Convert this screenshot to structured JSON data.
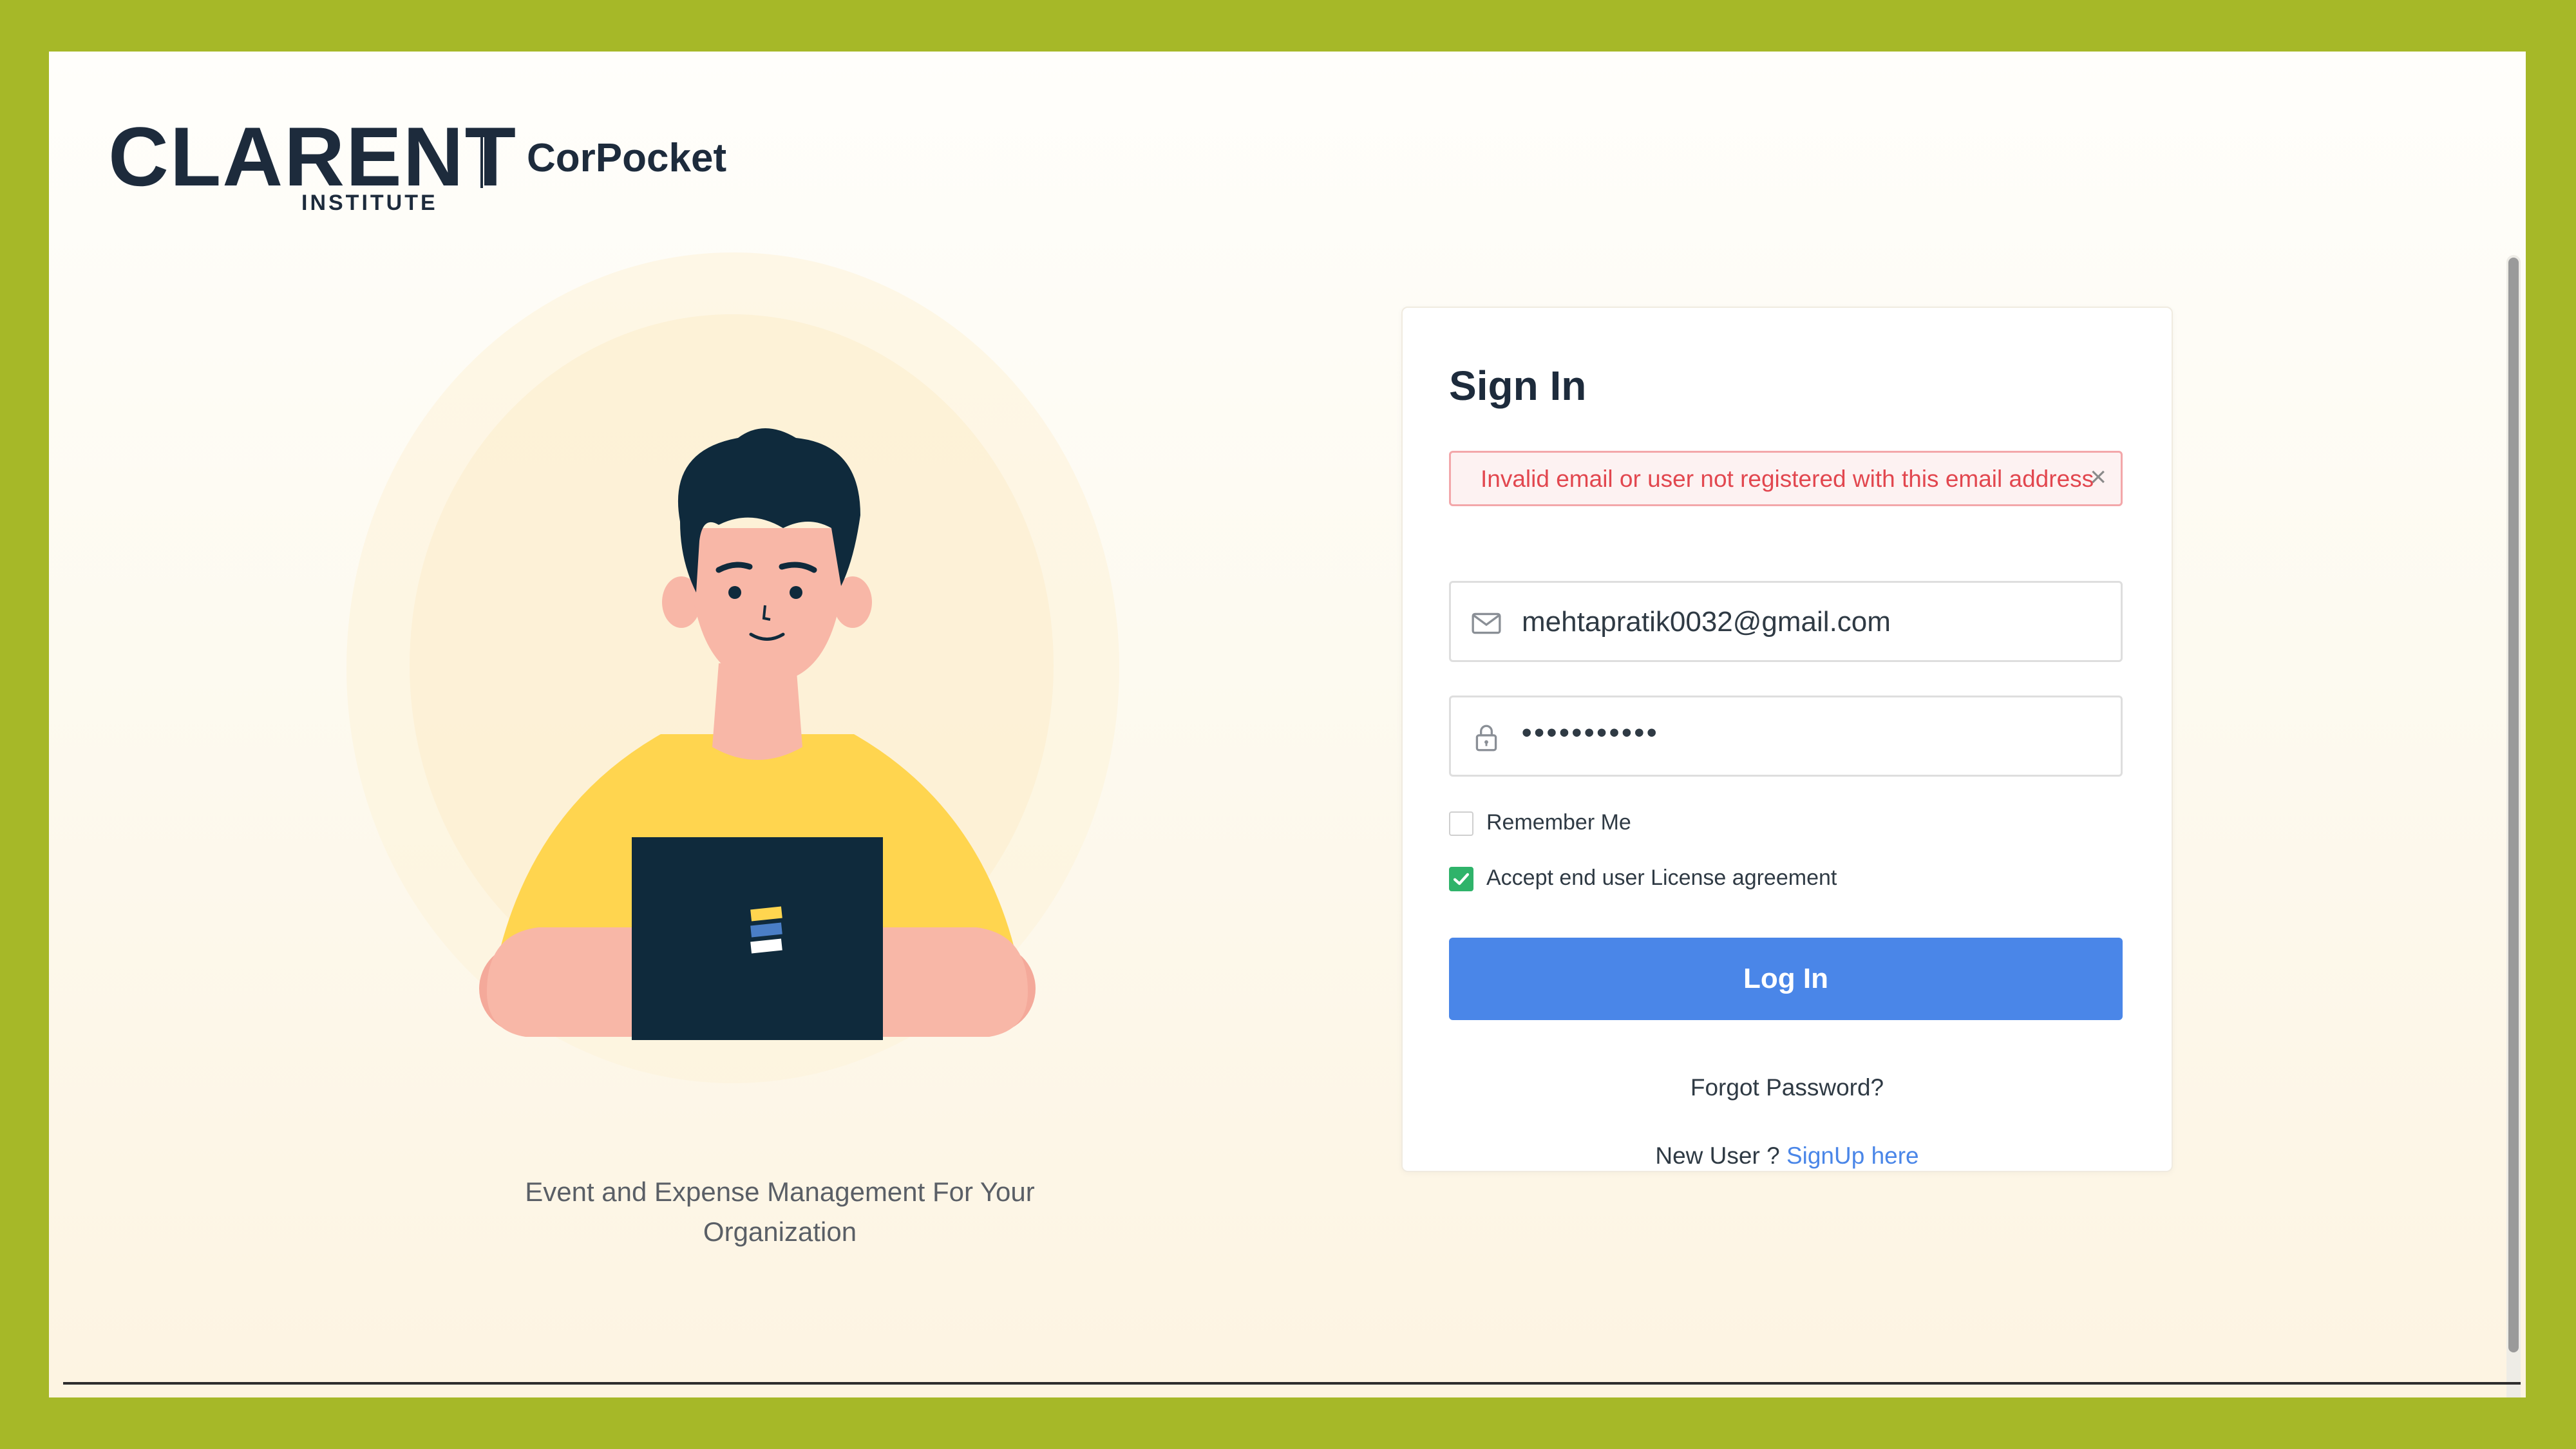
{
  "header": {
    "logo_text": "CLARENT",
    "logo_subtext": "INSTITUTE",
    "brand_name": "CorPocket"
  },
  "hero": {
    "tagline_line1": "Event and Expense Management For Your",
    "tagline_line2": "Organization"
  },
  "signin": {
    "title": "Sign In",
    "alert_message": "Invalid email or user not registered with this email address",
    "alert_close": "×",
    "email_value": "mehtapratik0032@gmail.com",
    "password_value": "•••••••••••",
    "remember_label": "Remember Me",
    "accept_label": "Accept end user License agreement",
    "login_button": "Log In",
    "forgot_link": "Forgot Password?",
    "new_user_prefix": "New User ?",
    "signup_link": "SignUp here"
  },
  "state": {
    "remember_checked": false,
    "accept_checked": true
  },
  "colors": {
    "outer_border": "#a6b828",
    "primary_button": "#4a86e8",
    "error_text": "#e2474f",
    "error_border": "#f3a7aa",
    "checkbox_checked": "#2fb36a",
    "heading_text": "#1d2b3c",
    "laptop": "#0f2a3c",
    "shirt": "#ffd54f"
  },
  "icons": {
    "email": "envelope-icon",
    "password": "lock-icon",
    "alert_close": "close-icon",
    "checkbox": "check-icon"
  }
}
